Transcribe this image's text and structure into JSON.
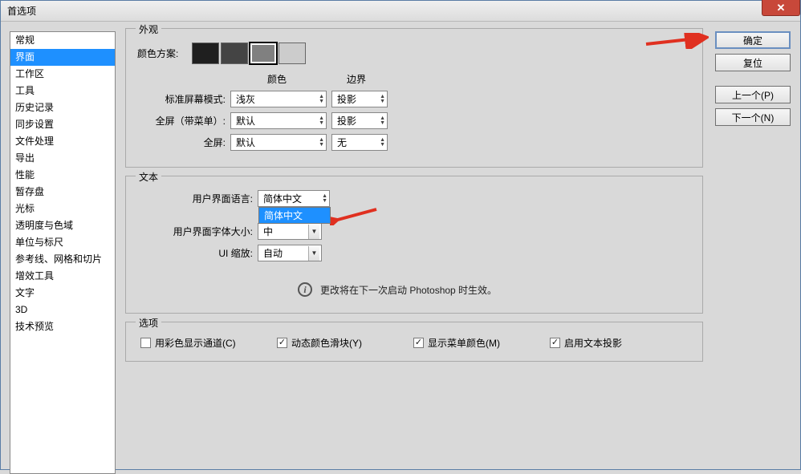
{
  "window": {
    "title": "首选项"
  },
  "sidebar": {
    "items": [
      "常规",
      "界面",
      "工作区",
      "工具",
      "历史记录",
      "同步设置",
      "文件处理",
      "导出",
      "性能",
      "暂存盘",
      "光标",
      "透明度与色域",
      "单位与标尺",
      "参考线、网格和切片",
      "增效工具",
      "文字",
      "3D",
      "技术预览"
    ],
    "selected_index": 1
  },
  "appearance": {
    "legend": "外观",
    "color_scheme_label": "颜色方案:",
    "swatches": [
      "#1f1f1f",
      "#444444",
      "#808080",
      "#cccccc"
    ],
    "selected_swatch": 2,
    "col_color": "颜色",
    "col_border": "边界",
    "rows": [
      {
        "label": "标准屏幕模式:",
        "color": "浅灰",
        "border": "投影"
      },
      {
        "label": "全屏（带菜单）:",
        "color": "默认",
        "border": "投影"
      },
      {
        "label": "全屏:",
        "color": "默认",
        "border": "无"
      }
    ]
  },
  "text": {
    "legend": "文本",
    "lang_label": "用户界面语言:",
    "lang_value": "简体中文",
    "lang_option": "简体中文",
    "font_label": "用户界面字体大小:",
    "font_value": "中",
    "scale_label": "UI 缩放:",
    "scale_value": "自动",
    "info": "更改将在下一次启动 Photoshop 时生效。"
  },
  "options": {
    "legend": "选项",
    "cb1": {
      "checked": false,
      "label": "用彩色显示通道(C)"
    },
    "cb2": {
      "checked": true,
      "label": "动态颜色滑块(Y)"
    },
    "cb3": {
      "checked": true,
      "label": "显示菜单颜色(M)"
    },
    "cb4": {
      "checked": true,
      "label": "启用文本投影"
    }
  },
  "buttons": {
    "ok": "确定",
    "reset": "复位",
    "prev": "上一个(P)",
    "next": "下一个(N)"
  }
}
